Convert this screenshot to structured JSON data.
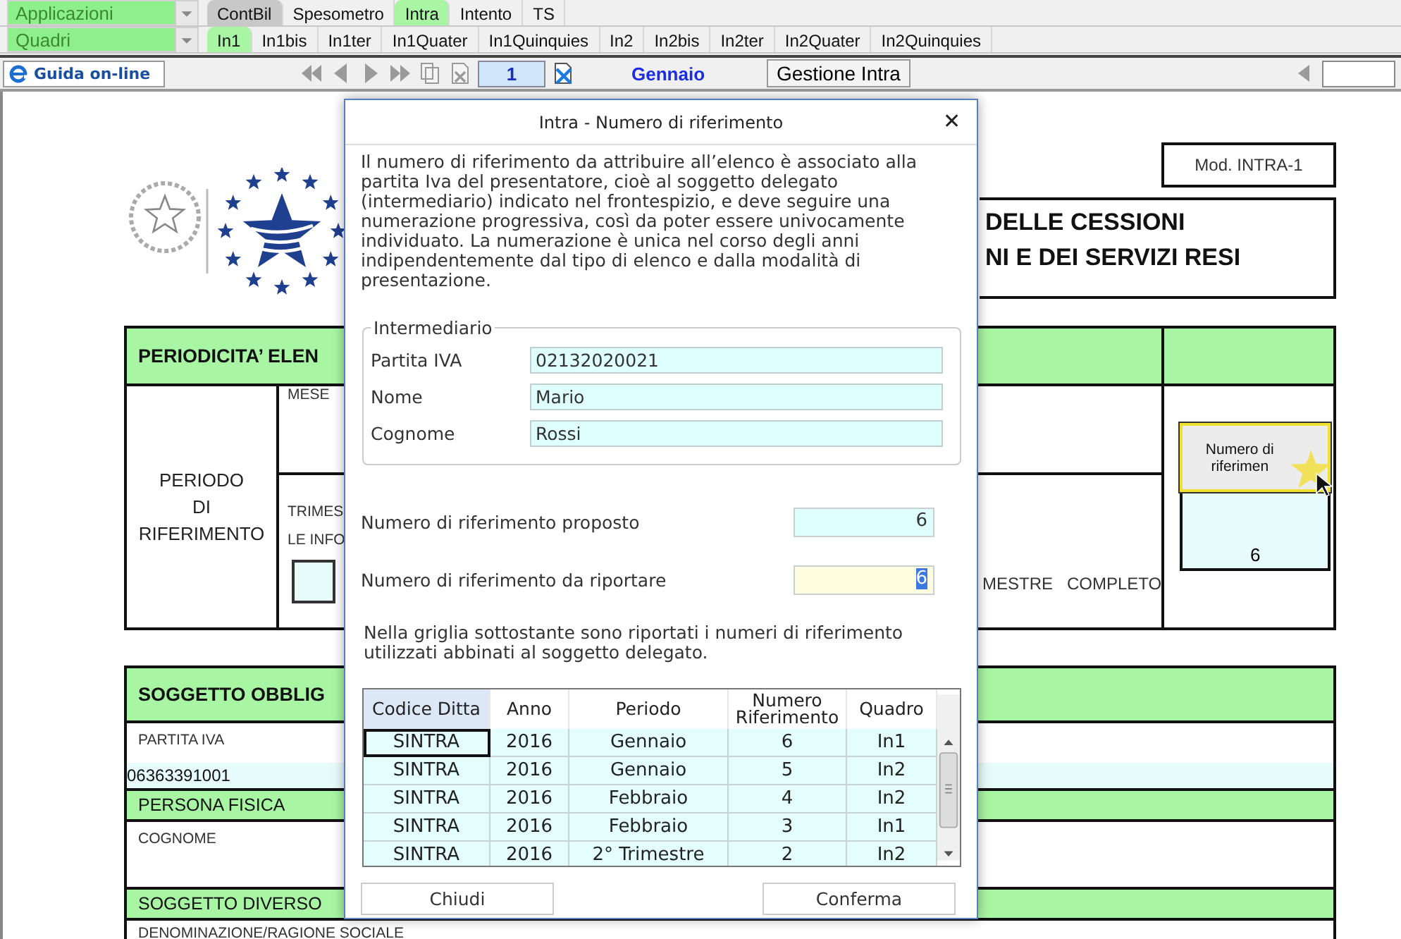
{
  "menu_rows": [
    {
      "selector": "Applicazioni",
      "tabs": [
        {
          "label": "ContBil",
          "selected": false,
          "pressed": true
        },
        {
          "label": "Spesometro",
          "selected": false,
          "pressed": false
        },
        {
          "label": "Intra",
          "selected": true,
          "pressed": false
        },
        {
          "label": "Intento",
          "selected": false,
          "pressed": false
        },
        {
          "label": "TS",
          "selected": false,
          "pressed": false
        }
      ]
    },
    {
      "selector": "Quadri",
      "tabs": [
        {
          "label": "In1",
          "selected": true,
          "pressed": false
        },
        {
          "label": "In1bis",
          "selected": false,
          "pressed": false
        },
        {
          "label": "In1ter",
          "selected": false,
          "pressed": false
        },
        {
          "label": "In1Quater",
          "selected": false,
          "pressed": false
        },
        {
          "label": "In1Quinquies",
          "selected": false,
          "pressed": false
        },
        {
          "label": "In2",
          "selected": false,
          "pressed": false
        },
        {
          "label": "In2bis",
          "selected": false,
          "pressed": false
        },
        {
          "label": "In2ter",
          "selected": false,
          "pressed": false
        },
        {
          "label": "In2Quater",
          "selected": false,
          "pressed": false
        },
        {
          "label": "In2Quinquies",
          "selected": false,
          "pressed": false
        }
      ]
    }
  ],
  "toolbar": {
    "help_button": "Guida on-line",
    "page": "1",
    "month": "Gennaio",
    "manage_button": "Gestione Intra"
  },
  "form": {
    "mod_label": "Mod. INTRA-1",
    "title_lines": [
      "DELLE CESSIONI",
      "NI E DEI SERVIZI RESI"
    ],
    "periodicity": {
      "header": "PERIODICITA’ ELEN",
      "period_label": "PERIODO\nDI\nRIFERIMENTO",
      "month_label": "MESE",
      "quarter_label": "TRIMES",
      "info_label": "LE INFO",
      "info_checked": false,
      "quarter_option": "MESTRE   COMPLETO",
      "ref_button": "Numero di riferimen",
      "ref_value": "6"
    },
    "subject": {
      "header": "SOGGETTO OBBLIG",
      "vat_label": "PARTITA IVA",
      "vat_value": "06363391001",
      "person_header": "PERSONA FISICA",
      "surname_label": "COGNOME",
      "other_header": "SOGGETTO DIVERSO",
      "company_label": "DENOMINAZIONE/RAGIONE SOCIALE"
    }
  },
  "dialog": {
    "title": "Intra - Numero di riferimento",
    "close": "✕",
    "intro": "Il numero di riferimento da attribuire all’elenco è associato alla partita Iva del presentatore, cioè al soggetto delegato (intermediario) indicato nel frontespizio, e deve seguire una numerazione progressiva, così da poter essere univocamente individuato. La numerazione è unica nel corso degli anni indipendentemente dal tipo di elenco e dalla modalità di presentazione.",
    "group": {
      "legend": "Intermediario",
      "fields": [
        {
          "label": "Partita IVA",
          "value": "02132020021"
        },
        {
          "label": "Nome",
          "value": "Mario"
        },
        {
          "label": "Cognome",
          "value": "Rossi"
        }
      ]
    },
    "proposed": {
      "label": "Numero di riferimento proposto",
      "value": "6"
    },
    "to_report": {
      "label": "Numero di riferimento da riportare",
      "value": "6",
      "text_selected": true
    },
    "grid_note": "Nella griglia sottostante sono riportati i numeri di riferimento utilizzati abbinati al soggetto delegato.",
    "table": {
      "columns": [
        {
          "label": "Codice Ditta",
          "selected": true
        },
        {
          "label": "Anno",
          "selected": false
        },
        {
          "label": "Periodo",
          "selected": false
        },
        {
          "label": "Numero Riferimento",
          "selected": false
        },
        {
          "label": "Quadro",
          "selected": false
        }
      ],
      "rows": [
        {
          "cells": [
            "SINTRA",
            "2016",
            "Gennaio",
            "6",
            "In1"
          ],
          "selected": true
        },
        {
          "cells": [
            "SINTRA",
            "2016",
            "Gennaio",
            "5",
            "In2"
          ],
          "selected": false
        },
        {
          "cells": [
            "SINTRA",
            "2016",
            "Febbraio",
            "4",
            "In2"
          ],
          "selected": false
        },
        {
          "cells": [
            "SINTRA",
            "2016",
            "Febbraio",
            "3",
            "In1"
          ],
          "selected": false
        },
        {
          "cells": [
            "SINTRA",
            "2016",
            "2° Trimestre",
            "2",
            "In2"
          ],
          "selected": false
        }
      ]
    },
    "buttons": [
      "Chiudi",
      "Conferma"
    ]
  }
}
